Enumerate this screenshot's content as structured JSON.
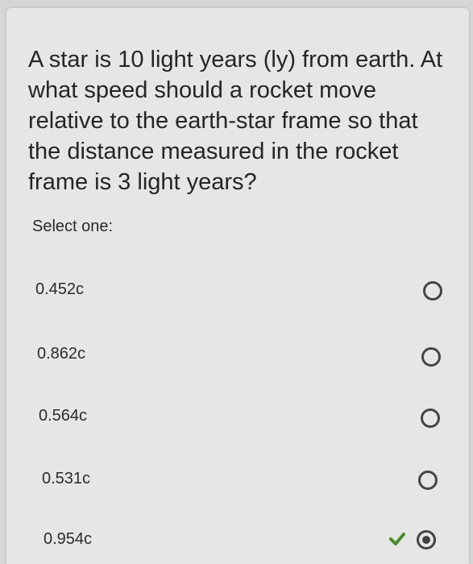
{
  "question": {
    "text": "A star is 10 light years (ly) from earth. At what speed should a rocket move relative to the earth-star frame so that the distance measured in the rocket frame is 3 light years?",
    "select_prompt": "Select one:"
  },
  "options": [
    {
      "label": "0.452c",
      "selected": false
    },
    {
      "label": "0.862c",
      "selected": false
    },
    {
      "label": "0.564c",
      "selected": false
    },
    {
      "label": "0.531c",
      "selected": false
    },
    {
      "label": "0.954c",
      "selected": true,
      "marked_correct": true
    }
  ],
  "icons": {
    "radio": "radio-button-icon",
    "check": "check-mark-icon"
  },
  "colors": {
    "check": "#4c8a2c",
    "radio": "#444444"
  }
}
